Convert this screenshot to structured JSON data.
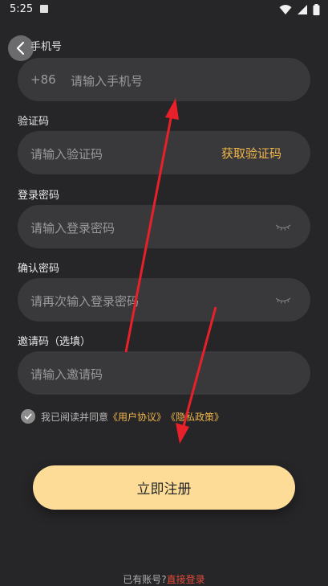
{
  "status_bar": {
    "time": "5:25",
    "notification_icon": "a-icon"
  },
  "phone": {
    "label": "手机号",
    "prefix": "+86",
    "placeholder": "请输入手机号"
  },
  "code": {
    "label": "验证码",
    "placeholder": "请输入验证码",
    "get_code": "获取验证码"
  },
  "password": {
    "label": "登录密码",
    "placeholder": "请输入登录密码"
  },
  "confirm": {
    "label": "确认密码",
    "placeholder": "请再次输入登录密码"
  },
  "invite": {
    "label": "邀请码（选填）",
    "placeholder": "请输入邀请码"
  },
  "agreement": {
    "prefix": "我已阅读并同意",
    "user_agreement": "《用户协议》",
    "privacy": "《隐私政策》"
  },
  "register_button": "立即注册",
  "footer": {
    "text": "已有账号?",
    "login_link": "直接登录"
  },
  "colors": {
    "accent": "#f0b64a",
    "button": "#fddc98",
    "link_red": "#e04a3a",
    "arrow": "#e8202a"
  }
}
